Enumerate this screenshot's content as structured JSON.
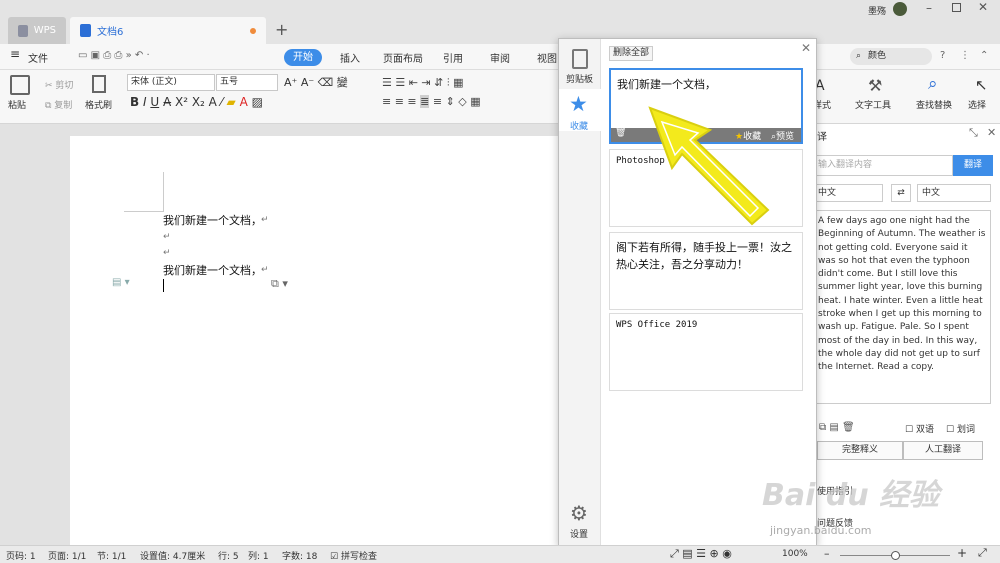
{
  "titlebar": {
    "tab1": "WPS",
    "tab2": "文档6",
    "user": "墨殇"
  },
  "menu": {
    "file": "文件",
    "start": "开始",
    "insert": "插入",
    "layout": "页面布局",
    "ref": "引用",
    "review": "审阅",
    "view": "视图",
    "search": "颜色"
  },
  "ribbon": {
    "paste": "粘贴",
    "cut": "剪切",
    "copy": "复制",
    "format_painter": "格式刷",
    "font": "宋体 (正文)",
    "size": "五号",
    "text_tools": "文字工具",
    "find_replace": "查找替换",
    "select": "选择",
    "style": "样式"
  },
  "doc": {
    "line1": "我们新建一个文档，",
    "line4": "我们新建一个文档，"
  },
  "clipboard": {
    "clipboard_tab": "剪贴板",
    "favorites_tab": "收藏",
    "settings": "设置",
    "delete_all": "删除全部",
    "fav_label": "收藏",
    "preview_label": "预览",
    "items": [
      "我们新建一个文档，",
      "Photoshop",
      "阁下若有所得，随手投上一票！汝之热心关注，吾之分享动力！",
      "WPS Office 2019"
    ]
  },
  "translate": {
    "title": "译",
    "input_placeholder": "输入翻译内容",
    "translate_btn": "翻译",
    "from": "中文",
    "to": "中文",
    "text": "A few days ago one night had the Beginning of Autumn. The weather is not getting cold. Everyone said it was so hot that even the typhoon didn't come. But I still love this summer light year, love this burning heat. I hate winter. Even a little heat stroke when I get up this morning to wash up. Fatigue. Pale. So I spent most of the day in bed. In this way, the whole day did not get up to surf the Internet. Read a copy.",
    "bilingual": "双语",
    "mark": "划词",
    "full_def": "完整释义",
    "human": "人工翻译",
    "guide": "使用指引",
    "feedback": "问题反馈"
  },
  "status": {
    "page": "页码: 1",
    "pages": "页面: 1/1",
    "section": "节: 1/1",
    "setting": "设置值: 4.7厘米",
    "row": "行: 5",
    "col": "列: 1",
    "words": "字数: 18",
    "spell": "拼写检查",
    "zoom": "100%"
  },
  "watermark": {
    "brand": "Bai du 经验",
    "url": "jingyan.baidu.com"
  },
  "colors": {
    "accent": "#3d8de8",
    "arrow": "#f3ea1c"
  }
}
